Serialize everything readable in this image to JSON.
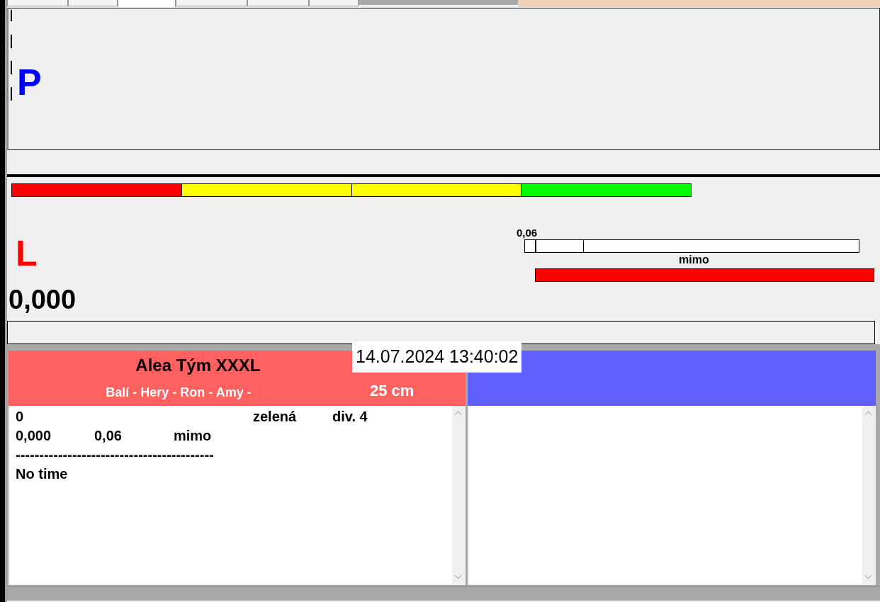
{
  "tabs": [
    {
      "selected": false
    },
    {
      "selected": false
    },
    {
      "selected": true
    },
    {
      "selected": false
    },
    {
      "selected": false
    },
    {
      "selected": false
    }
  ],
  "p_panel": {
    "label": "P"
  },
  "l_panel": {
    "label": "L",
    "color_bar": [
      {
        "color": "#ff0000"
      },
      {
        "color": "#ffff00"
      },
      {
        "color": "#ffff00"
      },
      {
        "color": "#00ff00"
      }
    ],
    "scale": {
      "label": "0,06",
      "level": 0.03
    },
    "status": {
      "label": "mimo",
      "color": "#ff0000"
    },
    "value": "0,000"
  },
  "teams": [
    {
      "name": "Alea Tým XXXL",
      "members": "Balí - Hery - Ron - Amy -",
      "distance": "25 cm",
      "color": "#ff6060",
      "log": [
        {
          "column_1": "0",
          "column_4": "zelená",
          "column_5": "div. 4"
        },
        {
          "column_1": "0,000",
          "column_2": "0,06",
          "column_3": "mimo"
        },
        {
          "column_1": "------------------------------------------"
        },
        {
          "column_1": "No time"
        }
      ]
    },
    {
      "color": "#6060ff"
    }
  ],
  "timestamp": "14.07.2024 13:40:02"
}
